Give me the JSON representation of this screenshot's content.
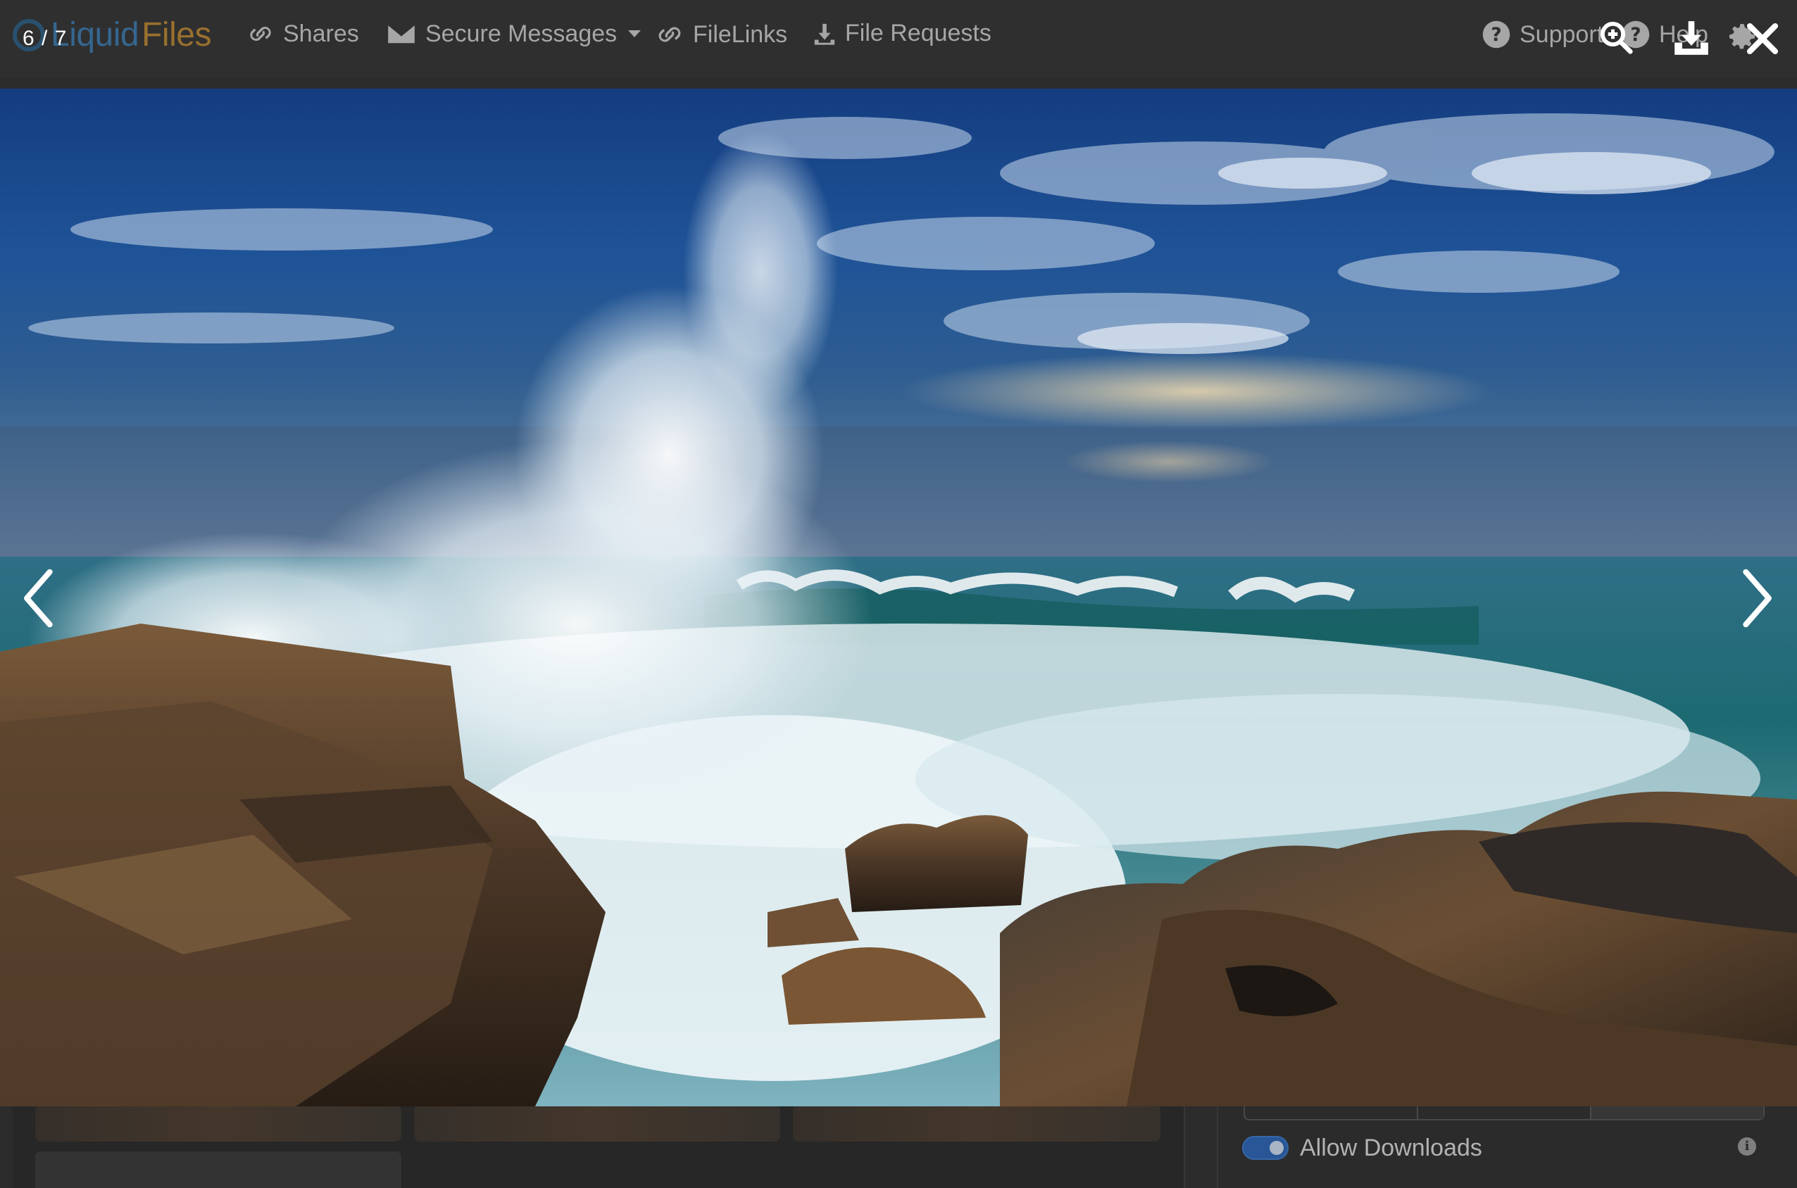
{
  "app": {
    "brand_part1": "Liquid",
    "brand_part2": "Files",
    "nav": {
      "shares": "Shares",
      "secure_messages": "Secure Messages",
      "filelinks": "FileLinks",
      "file_requests": "File Requests",
      "support": "Support",
      "help": "Help"
    },
    "sidebar": {
      "allow_downloads_label": "Allow Downloads",
      "allow_downloads_enabled": true
    }
  },
  "lightbox": {
    "current_index": 6,
    "total": 7,
    "counter_text": "6 / 7",
    "image_description": "Waves crashing over brown rocks under a blue cloudy sky"
  },
  "colors": {
    "accent_blue": "#2d5ea3",
    "overlay_text": "#ffffff",
    "nav_bg": "#343434"
  },
  "icons": {
    "zoom": "zoom-in-icon",
    "download": "download-icon",
    "close": "close-icon",
    "prev": "chevron-left-icon",
    "next": "chevron-right-icon"
  }
}
